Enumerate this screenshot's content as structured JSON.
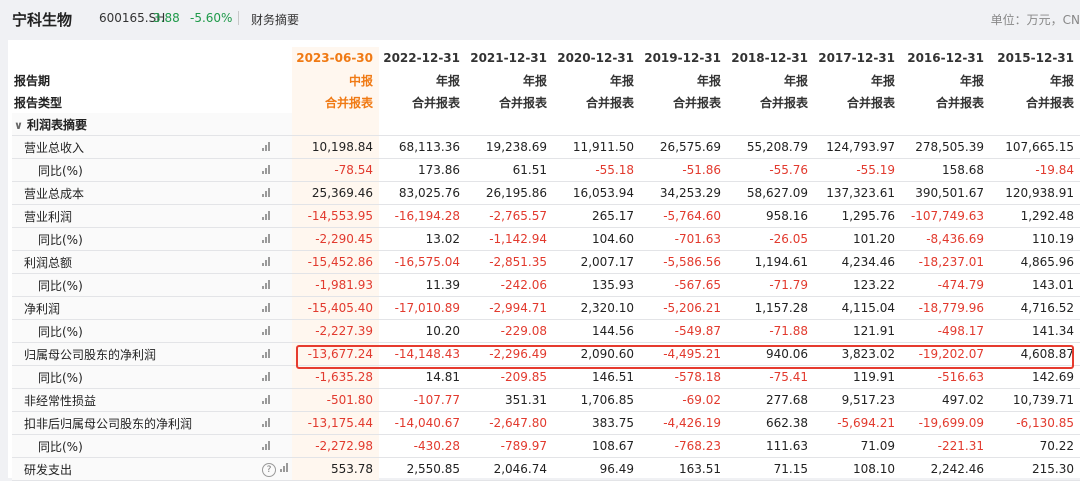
{
  "header": {
    "stock_name": "宁科生物",
    "stock_code": "600165.SH",
    "price": "3.88",
    "change_pct": "-5.60%",
    "section": "财务摘要",
    "unit": "单位：万元，CN"
  },
  "table": {
    "periods": [
      "2023-06-30",
      "2022-12-31",
      "2021-12-31",
      "2020-12-31",
      "2019-12-31",
      "2018-12-31",
      "2017-12-31",
      "2016-12-31",
      "2015-12-31"
    ],
    "row_report_period": {
      "label": "报告期",
      "values": [
        "中报",
        "年报",
        "年报",
        "年报",
        "年报",
        "年报",
        "年报",
        "年报",
        "年报"
      ]
    },
    "row_report_type": {
      "label": "报告类型",
      "values": [
        "合并报表",
        "合并报表",
        "合并报表",
        "合并报表",
        "合并报表",
        "合并报表",
        "合并报表",
        "合并报表",
        "合并报表"
      ]
    },
    "section_label": "利润表摘要",
    "rows": [
      {
        "label": "营业总收入",
        "indent": 1,
        "values": [
          "10,198.84",
          "68,113.36",
          "19,238.69",
          "11,911.50",
          "26,575.69",
          "55,208.79",
          "124,793.97",
          "278,505.39",
          "107,665.15"
        ]
      },
      {
        "label": "同比(%)",
        "indent": 2,
        "values": [
          "-78.54",
          "173.86",
          "61.51",
          "-55.18",
          "-51.86",
          "-55.76",
          "-55.19",
          "158.68",
          "-19.84"
        ]
      },
      {
        "label": "营业总成本",
        "indent": 1,
        "values": [
          "25,369.46",
          "83,025.76",
          "26,195.86",
          "16,053.94",
          "34,253.29",
          "58,627.09",
          "137,323.61",
          "390,501.67",
          "120,938.91"
        ]
      },
      {
        "label": "营业利润",
        "indent": 1,
        "values": [
          "-14,553.95",
          "-16,194.28",
          "-2,765.57",
          "265.17",
          "-5,764.60",
          "958.16",
          "1,295.76",
          "-107,749.63",
          "1,292.48"
        ]
      },
      {
        "label": "同比(%)",
        "indent": 2,
        "values": [
          "-2,290.45",
          "13.02",
          "-1,142.94",
          "104.60",
          "-701.63",
          "-26.05",
          "101.20",
          "-8,436.69",
          "110.19"
        ]
      },
      {
        "label": "利润总额",
        "indent": 1,
        "values": [
          "-15,452.86",
          "-16,575.04",
          "-2,851.35",
          "2,007.17",
          "-5,586.56",
          "1,194.61",
          "4,234.46",
          "-18,237.01",
          "4,865.96"
        ]
      },
      {
        "label": "同比(%)",
        "indent": 2,
        "values": [
          "-1,981.93",
          "11.39",
          "-242.06",
          "135.93",
          "-567.65",
          "-71.79",
          "123.22",
          "-474.79",
          "143.01"
        ]
      },
      {
        "label": "净利润",
        "indent": 1,
        "values": [
          "-15,405.40",
          "-17,010.89",
          "-2,994.71",
          "2,320.10",
          "-5,206.21",
          "1,157.28",
          "4,115.04",
          "-18,779.96",
          "4,716.52"
        ]
      },
      {
        "label": "同比(%)",
        "indent": 2,
        "values": [
          "-2,227.39",
          "10.20",
          "-229.08",
          "144.56",
          "-549.87",
          "-71.88",
          "121.91",
          "-498.17",
          "141.34"
        ]
      },
      {
        "label": "归属母公司股东的净利润",
        "indent": 1,
        "highlight": true,
        "values": [
          "-13,677.24",
          "-14,148.43",
          "-2,296.49",
          "2,090.60",
          "-4,495.21",
          "940.06",
          "3,823.02",
          "-19,202.07",
          "4,608.87"
        ]
      },
      {
        "label": "同比(%)",
        "indent": 2,
        "values": [
          "-1,635.28",
          "14.81",
          "-209.85",
          "146.51",
          "-578.18",
          "-75.41",
          "119.91",
          "-516.63",
          "142.69"
        ]
      },
      {
        "label": "非经常性损益",
        "indent": 1,
        "values": [
          "-501.80",
          "-107.77",
          "351.31",
          "1,706.85",
          "-69.02",
          "277.68",
          "9,517.23",
          "497.02",
          "10,739.71"
        ]
      },
      {
        "label": "扣非后归属母公司股东的净利润",
        "indent": 1,
        "values": [
          "-13,175.44",
          "-14,040.67",
          "-2,647.80",
          "383.75",
          "-4,426.19",
          "662.38",
          "-5,694.21",
          "-19,699.09",
          "-6,130.85"
        ]
      },
      {
        "label": "同比(%)",
        "indent": 2,
        "values": [
          "-2,272.98",
          "-430.28",
          "-789.97",
          "108.67",
          "-768.23",
          "111.63",
          "71.09",
          "-221.31",
          "70.22"
        ]
      },
      {
        "label": "研发支出",
        "indent": 1,
        "help": true,
        "values": [
          "553.78",
          "2,550.85",
          "2,046.74",
          "96.49",
          "163.51",
          "71.15",
          "108.10",
          "2,242.46",
          "215.30"
        ]
      }
    ]
  },
  "colors": {
    "negative": "#e23a2e",
    "positive_change": "#1f9a4a",
    "accent": "#f07a14",
    "highlight_border": "#e63b2e"
  },
  "icons": {
    "chart": "bar-chart-icon",
    "help": "question-icon",
    "collapse": "chevron-down-icon"
  }
}
